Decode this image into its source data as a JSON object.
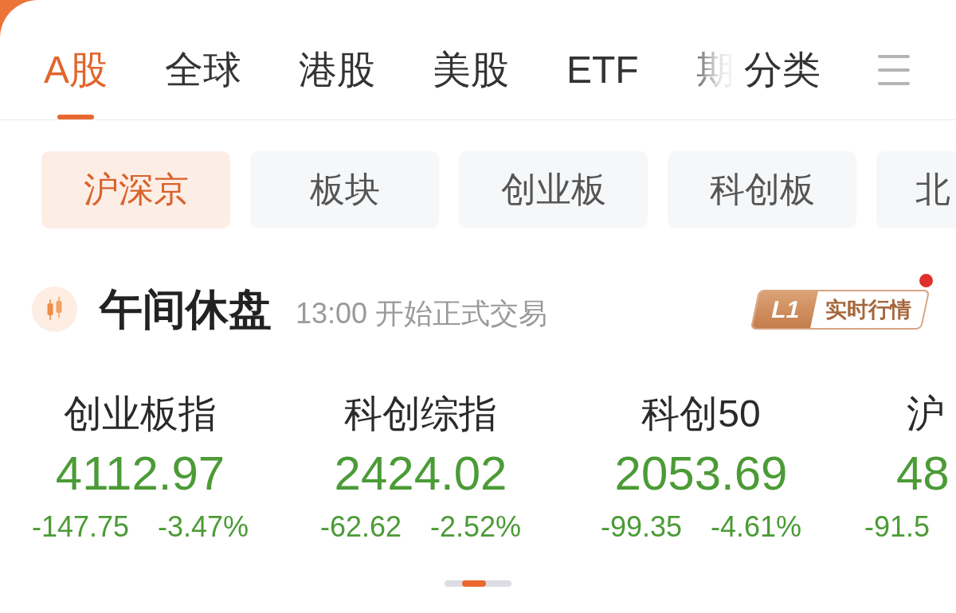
{
  "top_tabs": [
    {
      "label": "A股",
      "selected": true
    },
    {
      "label": "全球",
      "selected": false
    },
    {
      "label": "港股",
      "selected": false
    },
    {
      "label": "美股",
      "selected": false
    },
    {
      "label": "ETF",
      "selected": false
    },
    {
      "label": "期",
      "selected": false
    }
  ],
  "category_button": {
    "label": "分类"
  },
  "chips": [
    {
      "label": "沪深京",
      "selected": true
    },
    {
      "label": "板块",
      "selected": false
    },
    {
      "label": "创业板",
      "selected": false
    },
    {
      "label": "科创板",
      "selected": false
    },
    {
      "label": "北",
      "selected": false
    }
  ],
  "market_status": {
    "title": "午间休盘",
    "note": "13:00 开始正式交易"
  },
  "realtime_badge": {
    "tier": "L1",
    "label": "实时行情",
    "notification": true
  },
  "indices": [
    {
      "name": "创业板指",
      "value": "4112.97",
      "change": "-147.75",
      "percent": "-3.47%",
      "falling": true
    },
    {
      "name": "科创综指",
      "value": "2424.02",
      "change": "-62.62",
      "percent": "-2.52%",
      "falling": true
    },
    {
      "name": "科创50",
      "value": "2053.69",
      "change": "-99.35",
      "percent": "-4.61%",
      "falling": true
    },
    {
      "name": "沪",
      "value": "48",
      "change": "-91.5",
      "falling": true
    }
  ]
}
